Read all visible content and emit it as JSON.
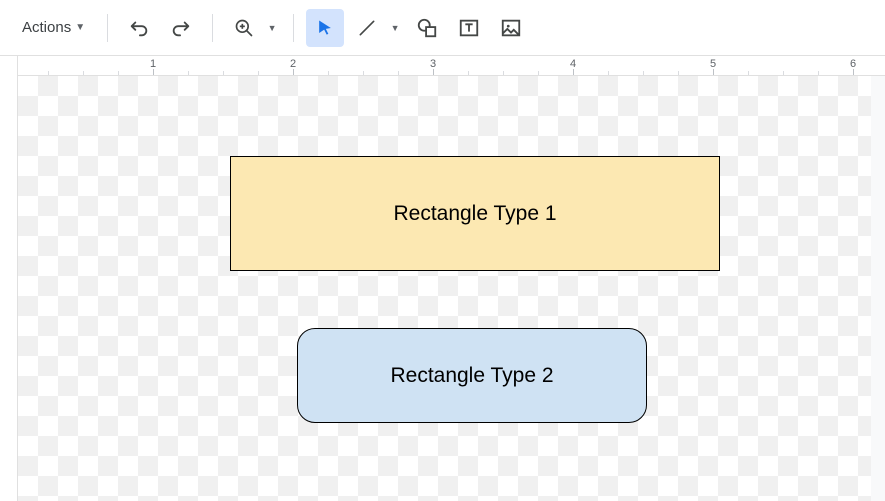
{
  "toolbar": {
    "actions_label": "Actions",
    "tools": {
      "undo": "undo",
      "redo": "redo",
      "zoom": "zoom",
      "select": "select",
      "line": "line",
      "shape": "shape",
      "textbox": "textbox",
      "image": "image"
    }
  },
  "ruler": {
    "marks": [
      "1",
      "2",
      "3",
      "4",
      "5",
      "6"
    ]
  },
  "shapes": {
    "rect1_label": "Rectangle Type 1",
    "rect2_label": "Rectangle Type 2"
  },
  "colors": {
    "rect1_fill": "#fce8b2",
    "rect2_fill": "#cfe2f3",
    "active_tool_bg": "#d3e3fd"
  }
}
